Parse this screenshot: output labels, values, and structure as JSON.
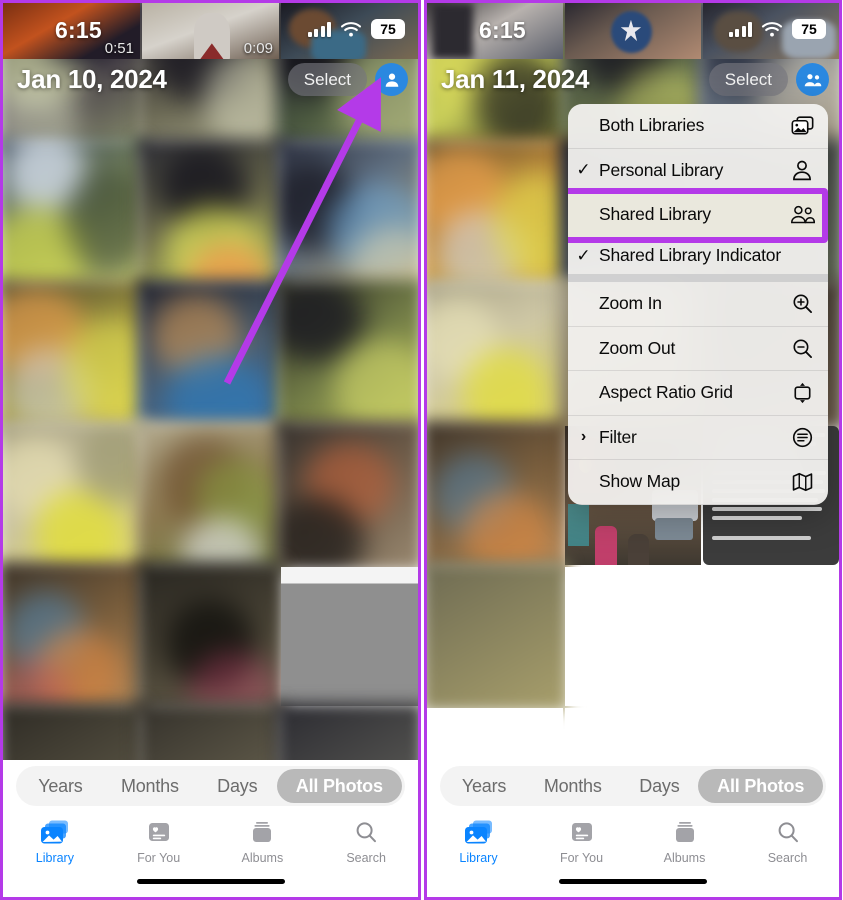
{
  "meta": {
    "accent_purple": "#b43ae8",
    "ios_blue": "#0a84ff",
    "avatar_blue": "#2a88e0"
  },
  "panels": [
    {
      "id": "left",
      "status": {
        "time": "6:15",
        "battery": "75",
        "signal_icon": "cellular-signal-icon",
        "wifi_icon": "wifi-icon"
      },
      "nav": {
        "title": "Jan 10, 2024",
        "select_label": "Select",
        "avatar_icon": "person-icon"
      },
      "video_durations": [
        "0:51",
        "0:09"
      ],
      "annotation": {
        "arrow_icon": "arrow-pointer-up-right",
        "points_to": "avatar-button"
      },
      "menu_open": false,
      "segmented": {
        "options": [
          "Years",
          "Months",
          "Days",
          "All Photos"
        ],
        "selected": "All Photos"
      },
      "tabs": [
        {
          "label": "Library",
          "icon": "photo-stack-icon",
          "active": true
        },
        {
          "label": "For You",
          "icon": "for-you-card-icon",
          "active": false
        },
        {
          "label": "Albums",
          "icon": "albums-book-icon",
          "active": false
        },
        {
          "label": "Search",
          "icon": "search-magnifier-icon",
          "active": false
        }
      ]
    },
    {
      "id": "right",
      "status": {
        "time": "6:15",
        "battery": "75",
        "signal_icon": "cellular-signal-icon",
        "wifi_icon": "wifi-icon"
      },
      "nav": {
        "title": "Jan 11, 2024",
        "select_label": "Select",
        "avatar_icon": "people-shared-icon"
      },
      "video_durations": [],
      "menu_open": true,
      "menu": {
        "items": [
          {
            "label": "Both Libraries",
            "checked": false,
            "icon": "both-libraries-photos-icon",
            "group_end": false,
            "highlighted": false,
            "has_chevron": false
          },
          {
            "label": "Personal Library",
            "checked": true,
            "icon": "person-icon",
            "group_end": false,
            "highlighted": false,
            "has_chevron": false
          },
          {
            "label": "Shared Library",
            "checked": false,
            "icon": "people-shared-icon",
            "group_end": false,
            "highlighted": true,
            "has_chevron": false
          },
          {
            "label": "Shared Library Indicator",
            "checked": true,
            "icon": "",
            "group_end": true,
            "highlighted": false,
            "has_chevron": false
          },
          {
            "label": "Zoom In",
            "checked": false,
            "icon": "magnifier-plus-icon",
            "group_end": false,
            "highlighted": false,
            "has_chevron": false
          },
          {
            "label": "Zoom Out",
            "checked": false,
            "icon": "magnifier-minus-icon",
            "group_end": false,
            "highlighted": false,
            "has_chevron": false
          },
          {
            "label": "Aspect Ratio Grid",
            "checked": false,
            "icon": "aspect-ratio-icon",
            "group_end": false,
            "highlighted": false,
            "has_chevron": false
          },
          {
            "label": "Filter",
            "checked": false,
            "icon": "filter-lines-icon",
            "group_end": false,
            "highlighted": false,
            "has_chevron": true
          },
          {
            "label": "Show Map",
            "checked": false,
            "icon": "map-icon",
            "group_end": false,
            "highlighted": false,
            "has_chevron": false
          }
        ],
        "highlight_target": "Shared Library"
      },
      "segmented": {
        "options": [
          "Years",
          "Months",
          "Days",
          "All Photos"
        ],
        "selected": "All Photos"
      },
      "tabs": [
        {
          "label": "Library",
          "icon": "photo-stack-icon",
          "active": true
        },
        {
          "label": "For You",
          "icon": "for-you-card-icon",
          "active": false
        },
        {
          "label": "Albums",
          "icon": "albums-book-icon",
          "active": false
        },
        {
          "label": "Search",
          "icon": "search-magnifier-icon",
          "active": false
        }
      ]
    }
  ]
}
